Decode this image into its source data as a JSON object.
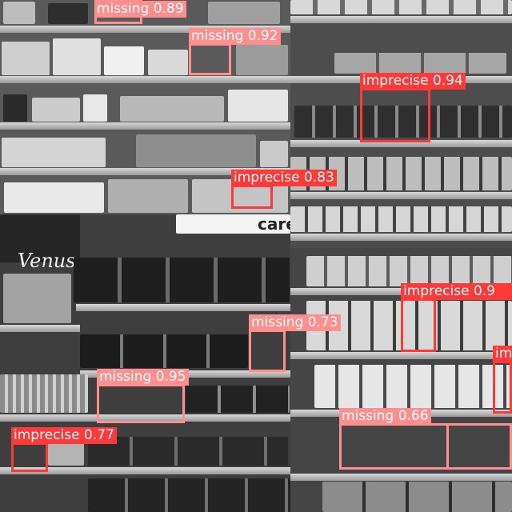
{
  "image": {
    "description_colors": {
      "missing": "#ff8f8f",
      "imprecise": "#ff3838"
    },
    "signage": {
      "venus": "Venus",
      "care": "care"
    }
  },
  "detections": [
    {
      "label": "missing 0.89"
    },
    {
      "label": "missing 0.92"
    },
    {
      "label": "imprecise 0.94"
    },
    {
      "label": "imprecise 0.83"
    },
    {
      "label": "missing 0.73"
    },
    {
      "label": "imprecise 0.9"
    },
    {
      "label": "missing 0.95"
    },
    {
      "label": "imprecise 0.77"
    },
    {
      "label": "missing 0.66"
    },
    {
      "label": "im"
    }
  ]
}
